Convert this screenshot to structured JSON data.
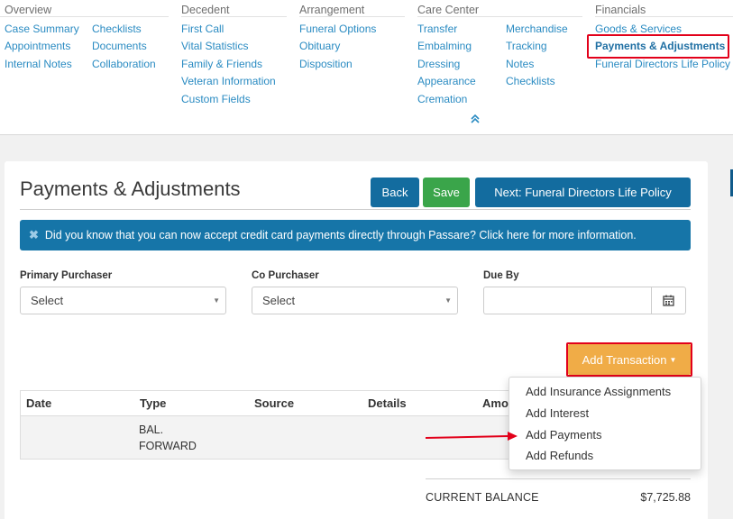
{
  "nav": {
    "sections": [
      {
        "header": "Overview",
        "links": [
          "Case Summary",
          "Checklists",
          "Appointments",
          "Documents",
          "Internal Notes",
          "Collaboration"
        ]
      },
      {
        "header": "Decedent",
        "links": [
          "First Call",
          "Vital Statistics",
          "Family & Friends",
          "Veteran Information",
          "Custom Fields"
        ]
      },
      {
        "header": "Arrangement",
        "links": [
          "Funeral Options",
          "Obituary",
          "Disposition"
        ]
      },
      {
        "header": "Care Center",
        "links": [
          "Transfer",
          "Merchandise",
          "Embalming",
          "Tracking",
          "Dressing",
          "Notes",
          "Appearance",
          "Checklists",
          "Cremation"
        ]
      },
      {
        "header": "Financials",
        "links": [
          "Goods & Services",
          "Payments & Adjustments",
          "Funeral Directors Life Policy"
        ]
      }
    ],
    "active_link": "Payments & Adjustments",
    "collapse_icon": "double-chevron-up-icon"
  },
  "page": {
    "title": "Payments & Adjustments",
    "buttons": {
      "back": "Back",
      "save": "Save",
      "next": "Next: Funeral Directors Life Policy"
    },
    "banner": "Did you know that you can now accept credit card payments directly through Passare? Click here for more information.",
    "fields": {
      "primary_purchaser": {
        "label": "Primary Purchaser",
        "value": "Select"
      },
      "co_purchaser": {
        "label": "Co Purchaser",
        "value": "Select"
      },
      "due_by": {
        "label": "Due By",
        "value": ""
      }
    },
    "add_transaction": "Add Transaction",
    "table": {
      "columns": [
        "Date",
        "Type",
        "Source",
        "Details",
        "Amo"
      ],
      "rows": [
        {
          "date": "",
          "type": "BAL. FORWARD",
          "source": "",
          "details": ""
        }
      ]
    },
    "menu": [
      "Add Insurance Assignments",
      "Add Interest",
      "Add Payments",
      "Add Refunds"
    ],
    "balance": {
      "label": "CURRENT BALANCE",
      "value": "$7,725.88"
    }
  },
  "colors": {
    "link": "#2a8bc2",
    "primary": "#136c9f",
    "success": "#3aa54a",
    "warning": "#f0ac47",
    "annotation": "#e2001a"
  }
}
